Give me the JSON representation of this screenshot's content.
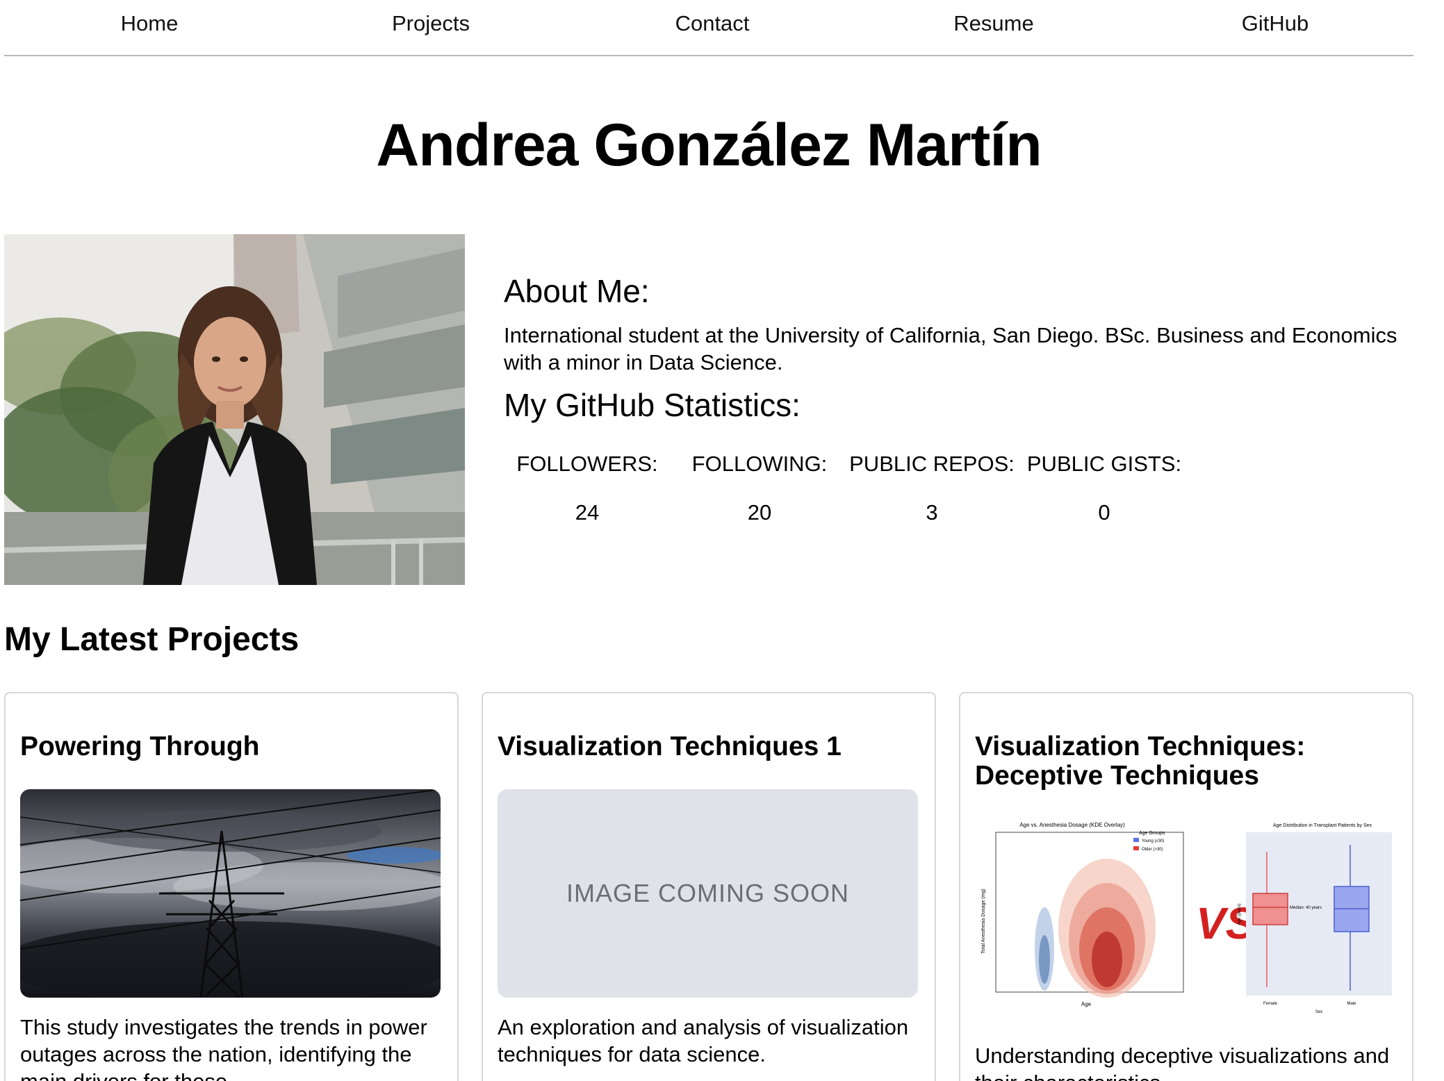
{
  "nav": {
    "items": [
      {
        "label": "Home"
      },
      {
        "label": "Projects"
      },
      {
        "label": "Contact"
      },
      {
        "label": "Resume"
      },
      {
        "label": "GitHub"
      }
    ]
  },
  "profile": {
    "name": "Andrea González Martín",
    "about_heading": "About Me:",
    "about_text": "International student at the University of California, San Diego. BSc. Business and Economics with a minor in Data Science.",
    "github_heading": "My GitHub Statistics:",
    "stats": [
      {
        "label": "FOLLOWERS:",
        "value": "24"
      },
      {
        "label": "FOLLOWING:",
        "value": "20"
      },
      {
        "label": "PUBLIC REPOS:",
        "value": "3"
      },
      {
        "label": "PUBLIC GISTS:",
        "value": "0"
      }
    ]
  },
  "projects": {
    "heading": "My Latest Projects",
    "cards": [
      {
        "title": "Powering Through",
        "description": "This study investigates the trends in power outages across the nation, identifying the main drivers for these",
        "image": "power-lines-storm-image"
      },
      {
        "title": "Visualization Techniques 1",
        "description": "An exploration and analysis of visualization techniques for data science.",
        "image_placeholder": "IMAGE COMING SOON"
      },
      {
        "title": "Visualization Techniques: Deceptive Techniques",
        "description": "Understanding deceptive visualizations and their characteristics.",
        "image": "kde-vs-boxplot-image",
        "image_text": {
          "left_title": "Age vs. Anesthesia Dosage (KDE Overlay)",
          "left_xlabel": "Age",
          "left_ylabel": "Total Anesthesia Dosage (mg)",
          "legend_title": "Age Groups",
          "legend_items": [
            "Young (≤30)",
            "Older (>30)"
          ],
          "vs": "VS",
          "right_title": "Age Distribution in Transplant Patients by Sex",
          "right_xlabel": "Sex",
          "right_ylabel": "Age (years)",
          "right_categories": [
            "Female",
            "Male"
          ],
          "median_label": "Median: 40 years"
        }
      }
    ]
  },
  "colors": {
    "nav_border": "#b8b8b8",
    "card_border": "#d7d7d7",
    "placeholder_bg": "#dfe2e8",
    "placeholder_text": "#6b6e73",
    "vs_red": "#d42020"
  }
}
